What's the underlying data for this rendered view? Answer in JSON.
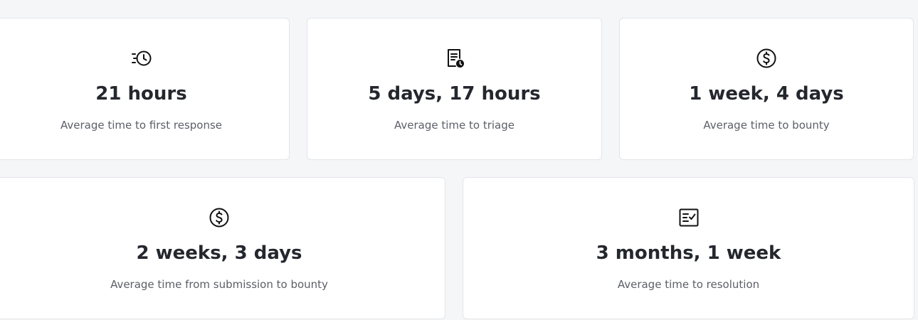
{
  "metrics": [
    {
      "icon": "fast-clock-icon",
      "value": "21 hours",
      "label": "Average time to first response"
    },
    {
      "icon": "document-clock-icon",
      "value": "5 days, 17 hours",
      "label": "Average time to triage"
    },
    {
      "icon": "dollar-circle-icon",
      "value": "1 week, 4 days",
      "label": "Average time to bounty"
    },
    {
      "icon": "dollar-circle-icon",
      "value": "2 weeks, 3 days",
      "label": "Average time from submission to bounty"
    },
    {
      "icon": "checklist-icon",
      "value": "3 months, 1 week",
      "label": "Average time to resolution"
    }
  ],
  "colors": {
    "background": "#f5f6f8",
    "card": "#ffffff",
    "value_text": "#25272e",
    "label_text": "#5c5f68",
    "icon": "#111111"
  }
}
